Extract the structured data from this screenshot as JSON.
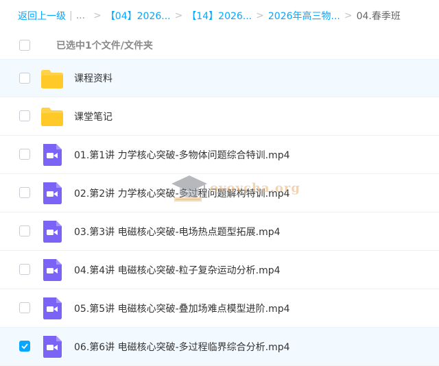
{
  "breadcrumb": {
    "back": "返回上一级",
    "ellipsis": "...",
    "items": [
      "【04】2026...",
      "【14】2026...",
      "2026年高三物..."
    ],
    "current": "04.春季班",
    "separator": ">",
    "divider": "|"
  },
  "selection": {
    "label": "已选中1个文件/文件夹"
  },
  "files": [
    {
      "name": "课程资料",
      "type": "folder",
      "checked": false
    },
    {
      "name": "课堂笔记",
      "type": "folder",
      "checked": false
    },
    {
      "name": "01.第1讲 力学核心突破-多物体问题综合特训.mp4",
      "type": "video",
      "checked": false
    },
    {
      "name": "02.第2讲 力学核心突破-多过程问题解构特训.mp4",
      "type": "video",
      "checked": false
    },
    {
      "name": "03.第3讲 电磁核心突破-电场热点题型拓展.mp4",
      "type": "video",
      "checked": false
    },
    {
      "name": "04.第4讲 电磁核心突破-粒子复杂运动分析.mp4",
      "type": "video",
      "checked": false
    },
    {
      "name": "05.第5讲 电磁核心突破-叠加场难点模型进阶.mp4",
      "type": "video",
      "checked": false
    },
    {
      "name": "06.第6讲 电磁核心突破-多过程临界综合分析.mp4",
      "type": "video",
      "checked": true
    }
  ],
  "watermark": {
    "text": "ovovcha.org"
  },
  "colors": {
    "accent": "#06a7ff",
    "folder": "#ffd24a",
    "video": "#7a63f5",
    "highlight_row": "#f2f9ff"
  }
}
